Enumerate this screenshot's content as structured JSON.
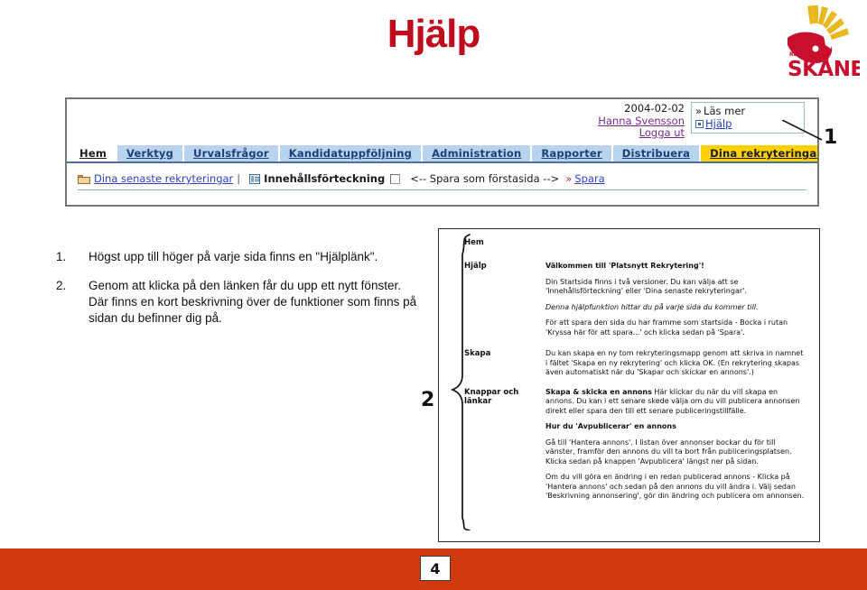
{
  "page_title": "Hjälp",
  "logo": {
    "name": "region-skane-logo",
    "top_text": "REGION",
    "main_text": "SKÅNE",
    "sun_color": "#E8B820",
    "mark_color": "#C8102E"
  },
  "colors": {
    "title_red": "#C00D1E",
    "footer_red": "#D03A0C",
    "nav_tab_blue": "#B9D3EC",
    "nav_active_yellow": "#FFD100",
    "link_blue": "#2A43C8",
    "link_purple": "#7A2A8A"
  },
  "top_screenshot": {
    "user_panel": {
      "date": "2004-02-02",
      "user_name": "Hanna Svensson",
      "logout": "Logga ut"
    },
    "read_more_box": {
      "chevron": "»",
      "read_more": "Läs mer",
      "help_icon": "expand-box-icon",
      "help": "Hjälp"
    },
    "nav_tabs": [
      {
        "label": "Hem",
        "state": "current"
      },
      {
        "label": "Verktyg",
        "state": "normal"
      },
      {
        "label": "Urvalsfrågor",
        "state": "normal"
      },
      {
        "label": "Kandidatuppföljning",
        "state": "normal"
      },
      {
        "label": "Administration",
        "state": "normal"
      },
      {
        "label": "Rapporter",
        "state": "normal"
      },
      {
        "label": "Distribuera",
        "state": "normal"
      },
      {
        "label": "Dina rekryteringar",
        "state": "active"
      }
    ],
    "toolbar": {
      "folder_icon": "folder-icon",
      "recent_link": "Dina senaste rekryteringar",
      "separator": "|",
      "list_icon": "list-view-icon",
      "toc_label": "Innehållsförteckning",
      "checkbox_icon": "checkbox-unchecked-icon",
      "save_hint": "<-- Spara som förstasida -->",
      "raquo": "»",
      "save_link": "Spara"
    }
  },
  "callouts": {
    "one": "1",
    "two": "2"
  },
  "steps": [
    {
      "number": "1.",
      "text": "Högst upp till höger på varje sida finns en \"Hjälplänk\"."
    },
    {
      "number": "2.",
      "text": "Genom att klicka på den länken får du upp ett nytt fönster. Där finns en kort beskrivning över de funktioner som finns på sidan du befinner dig på."
    }
  ],
  "help_window": {
    "sections": [
      {
        "label": "Hem",
        "paragraphs": []
      },
      {
        "label": "Hjälp",
        "paragraphs": [
          {
            "style": "title",
            "text": "Välkommen till 'Platsnytt Rekrytering'!"
          },
          {
            "style": "normal",
            "text": "Din Startsida finns i två versioner. Du kan välja att se 'Innehållsförteckning' eller 'Dina senaste rekryteringar'."
          },
          {
            "style": "italic",
            "text": "Denna hjälpfunktion hittar du på varje sida du kommer till."
          },
          {
            "style": "normal",
            "text": "För att spara den sida du har framme som startsida - Bocka i rutan 'Kryssa här för att spara...' och klicka sedan på 'Spara'."
          }
        ]
      },
      {
        "label": "Skapa",
        "paragraphs": [
          {
            "style": "normal",
            "text": "Du kan skapa en ny tom rekryteringsmapp genom att skriva in namnet i fältet 'Skapa en ny rekrytering' och klicka OK. (En rekrytering skapas även automatiskt när du 'Skapar och skickar en annons'.)"
          }
        ]
      },
      {
        "label": "Knappar och länkar",
        "paragraphs": [
          {
            "style": "lead-bold",
            "lead": "Skapa & skicka en annons",
            "text": " Här klickar du när du vill skapa en annons. Du kan i ett senare skede välja om du vill publicera annonsen direkt eller spara den till ett senare publiceringstillfälle."
          },
          {
            "style": "title",
            "text": "Hur du 'Avpublicerar' en annons"
          },
          {
            "style": "normal",
            "text": "Gå till 'Hantera annons'. I listan över annonser bockar du för till vänster, framför den annons du vill ta bort från publiceringsplatsen. Klicka sedan på knappen 'Avpublicera' längst ner på sidan."
          },
          {
            "style": "normal",
            "text": "Om du vill göra en ändring i en redan publicerad annons - Klicka på 'Hantera annons' och sedan på den annons du vill ändra i. Välj sedan 'Beskrivning annonsering', gör din ändring och publicera om annonsen."
          }
        ]
      }
    ]
  },
  "footer": {
    "page_number": "4"
  }
}
